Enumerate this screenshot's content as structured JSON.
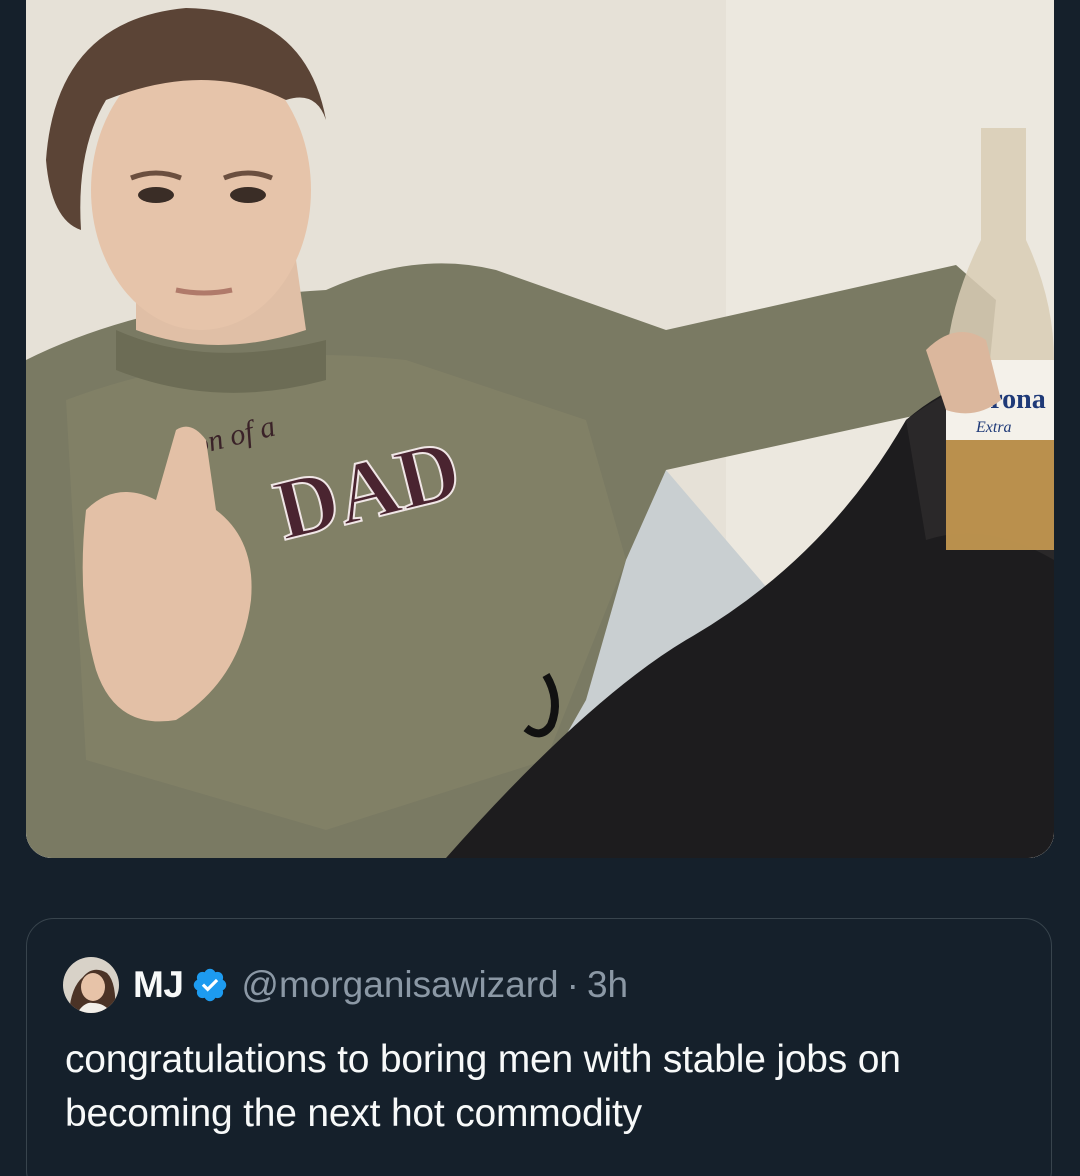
{
  "media": {
    "sweatshirt_text_top": "on of a",
    "sweatshirt_text_main": "DAD",
    "bottle_label_brand": "Corona",
    "bottle_label_sub": "Extra"
  },
  "quote": {
    "display_name": "MJ",
    "handle": "@morganisawizard",
    "separator": "·",
    "time": "3h",
    "text": "congratulations to boring men with stable jobs on becoming the next hot commodity"
  },
  "colors": {
    "background": "#15202b",
    "border": "#38444d",
    "primary_text": "#f7f9f9",
    "secondary_text": "#8b98a5",
    "verified_blue": "#1d9bf0"
  },
  "icons": {
    "verified": "verified-badge-icon",
    "avatar": "profile-avatar"
  }
}
